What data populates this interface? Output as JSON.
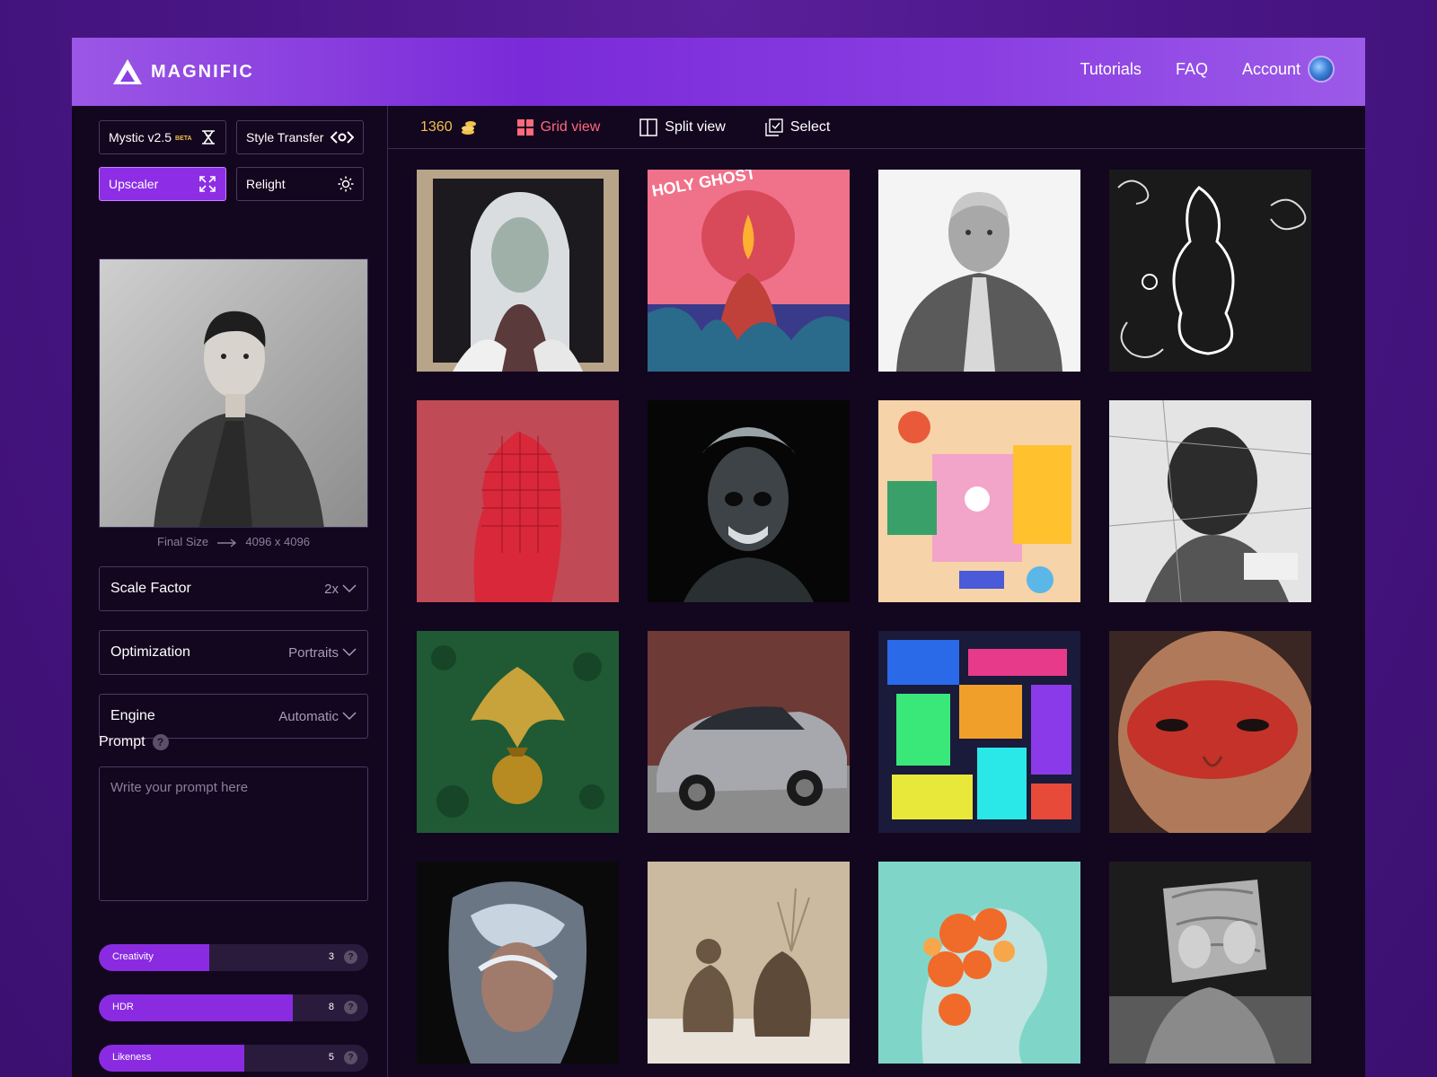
{
  "brand": {
    "name": "MAGNIFIC"
  },
  "nav": {
    "tutorials": "Tutorials",
    "faq": "FAQ",
    "account": "Account"
  },
  "tools": {
    "mystic": {
      "label": "Mystic v2.5",
      "badge": "BETA"
    },
    "style_transfer": {
      "label": "Style Transfer"
    },
    "upscaler": {
      "label": "Upscaler",
      "active": true
    },
    "relight": {
      "label": "Relight"
    }
  },
  "preview": {
    "final_size_label": "Final Size",
    "final_size_value": "4096 x 4096"
  },
  "settings": {
    "scale_factor": {
      "label": "Scale Factor",
      "value": "2x"
    },
    "optimization": {
      "label": "Optimization",
      "value": "Portraits"
    },
    "engine": {
      "label": "Engine",
      "value": "Automatic"
    }
  },
  "prompt": {
    "label": "Prompt",
    "placeholder": "Write your prompt here"
  },
  "sliders": [
    {
      "label": "Creativity",
      "value": "3",
      "level": 0.41
    },
    {
      "label": "HDR",
      "value": "8",
      "level": 0.72
    },
    {
      "label": "Likeness",
      "value": "5",
      "level": 0.54
    }
  ],
  "toolbar": {
    "credits": "1360",
    "grid_view": "Grid view",
    "split_view": "Split view",
    "select": "Select",
    "active_view": "grid"
  },
  "gallery_texts": {
    "holy_ghost": "HOLY GHOST"
  },
  "colors": {
    "accent": "#8a2be2",
    "header_start": "#9b57e6",
    "header_end": "#7a2ad8",
    "credits": "#f2c24b",
    "active_view": "#ff6a7a",
    "panel_bg": "#13061f"
  }
}
